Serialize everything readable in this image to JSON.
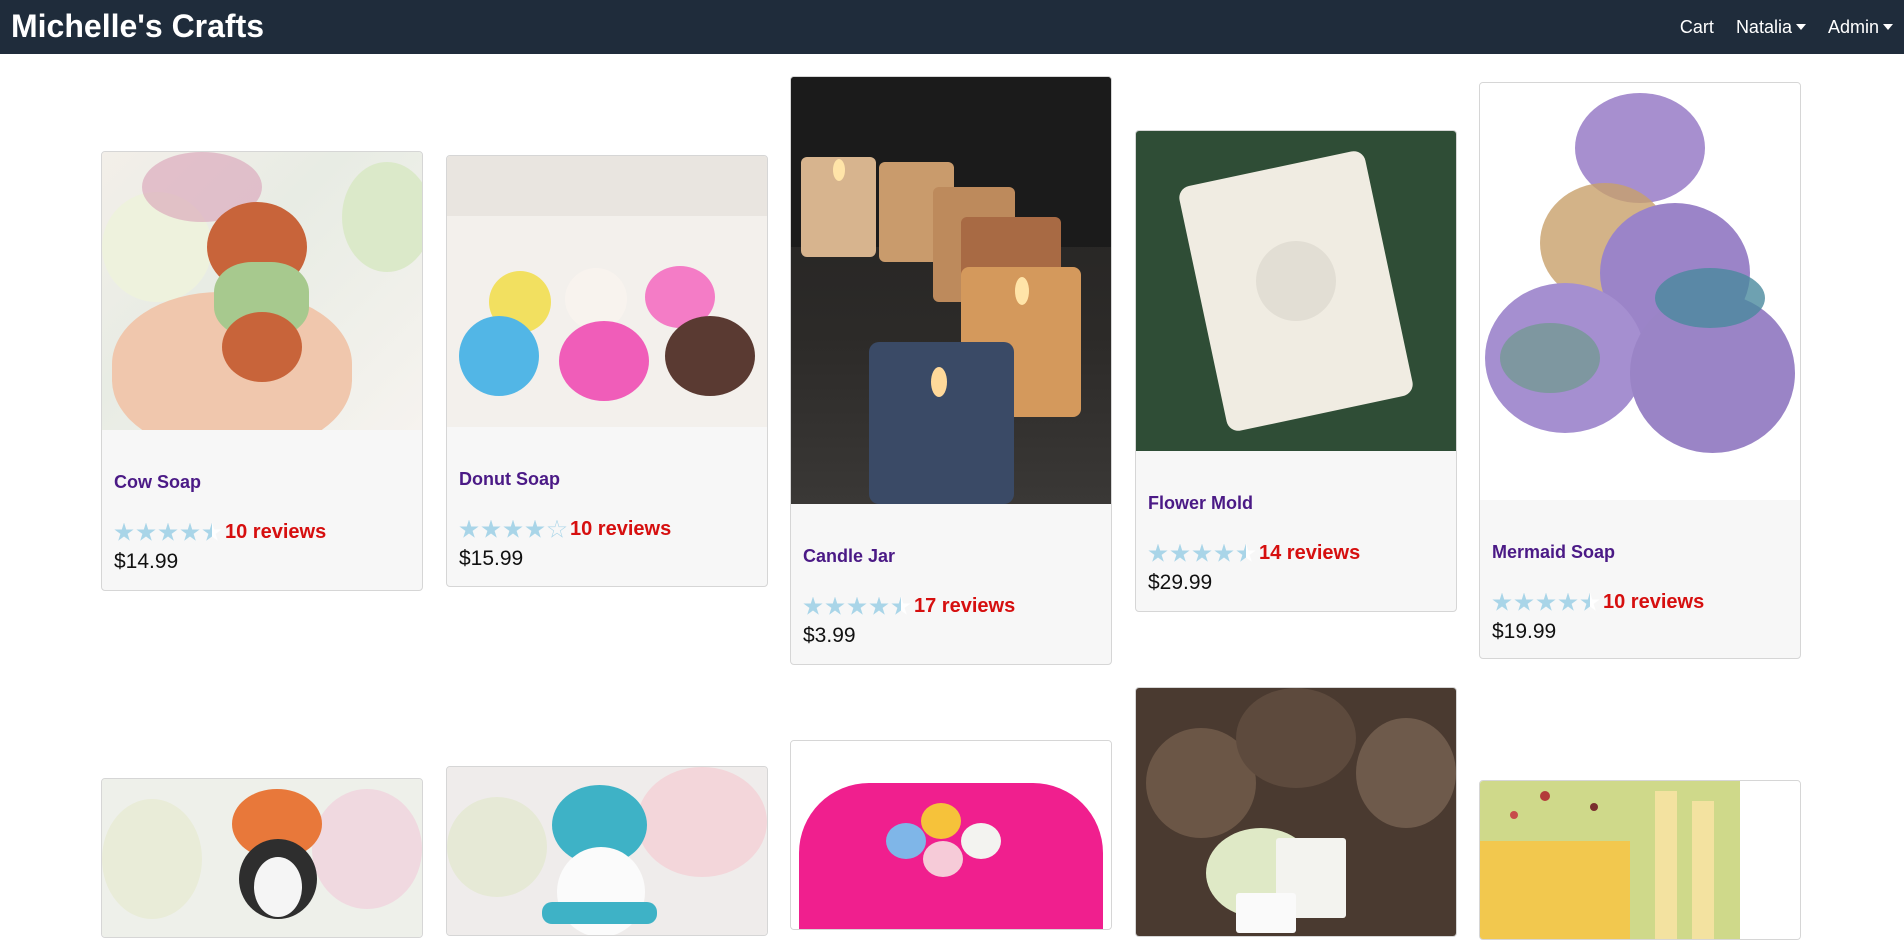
{
  "navbar": {
    "brand": "Michelle's Crafts",
    "cart": "Cart",
    "user_menu": "Natalia",
    "admin_menu": "Admin"
  },
  "colors": {
    "navbar_bg": "#1f2c3b",
    "title": "#4b1a86",
    "reviews": "#d60f0f",
    "star": "#a9d5e8"
  },
  "products": [
    {
      "name": "Cow Soap",
      "rating": 4.5,
      "reviews": "10 reviews",
      "price": "$14.99"
    },
    {
      "name": "Donut Soap",
      "rating": 4,
      "reviews": "10 reviews",
      "price": "$15.99"
    },
    {
      "name": "Candle Jar",
      "rating": 4.5,
      "reviews": "17 reviews",
      "price": "$3.99"
    },
    {
      "name": "Flower Mold",
      "rating": 4.5,
      "reviews": "14 reviews",
      "price": "$29.99"
    },
    {
      "name": "Mermaid Soap",
      "rating": 4.5,
      "reviews": "10 reviews",
      "price": "$19.99"
    }
  ]
}
